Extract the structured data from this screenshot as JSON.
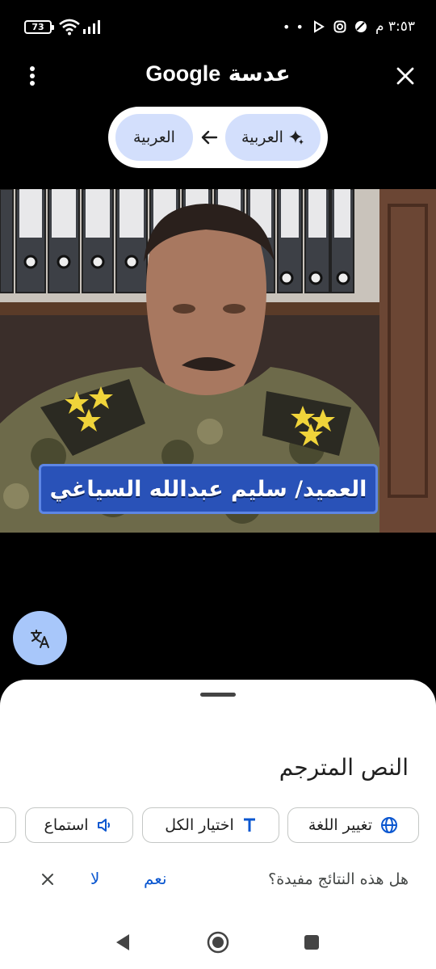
{
  "status_bar": {
    "battery": "73",
    "clock": "٣:٥٣ م",
    "overflow": "• •"
  },
  "header": {
    "title_brand": "Google",
    "title_word": "عدسة",
    "menu_icon": "more-vert-icon",
    "close_icon": "close-icon"
  },
  "language": {
    "source": "العربية",
    "target": "العربية",
    "source_icon": "sparkle-icon",
    "arrow_icon": "arrow-left-icon"
  },
  "image": {
    "caption": "العميد/ سليم عبدالله السياغي"
  },
  "fab": {
    "icon": "translate-icon"
  },
  "sheet": {
    "title": "النص المترجم",
    "chips": {
      "change_language": "تغيير اللغة",
      "select_all": "اختيار الكل",
      "listen": "استماع"
    },
    "feedback": {
      "question": "هل هذه النتائج مفيدة؟",
      "yes": "نعم",
      "no": "لا"
    }
  },
  "colors": {
    "accent": "#0b57d0",
    "chip_bg": "#d3dffc",
    "fab_bg": "#a8c7fa"
  }
}
